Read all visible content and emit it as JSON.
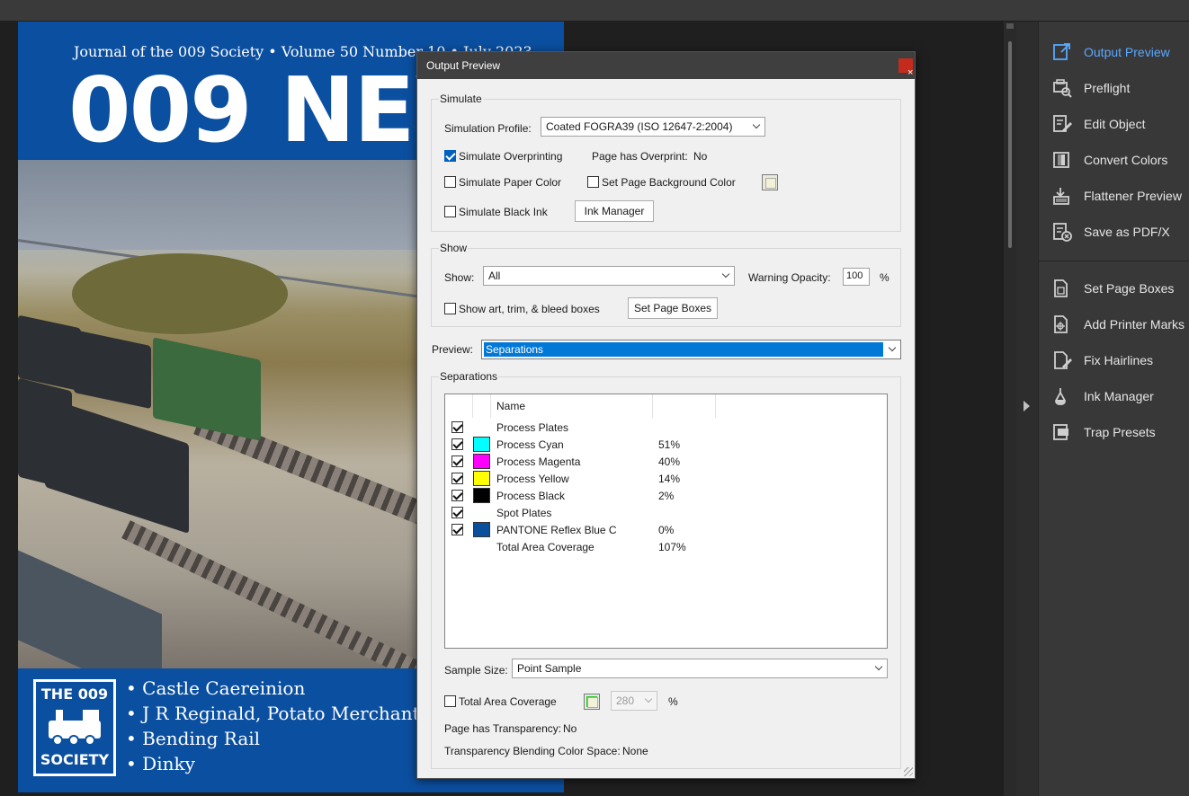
{
  "document": {
    "journal_line": "Journal of the 009 Society • Volume 50 Number 10 • July 2023",
    "big_title": "009 NEWS",
    "logo_top": "THE 009",
    "logo_bottom": "SOCIETY",
    "bullets": [
      "• Castle Caereinion",
      "• J R Reginald, Potato Merchant",
      "• Bending Rail",
      "• Dinky"
    ],
    "brand_blue": "#0b4fa0"
  },
  "tools_panel": {
    "items": [
      {
        "label": "Output Preview",
        "icon": "output-preview-icon",
        "active": true
      },
      {
        "label": "Preflight",
        "icon": "preflight-icon"
      },
      {
        "label": "Edit Object",
        "icon": "edit-object-icon"
      },
      {
        "label": "Convert Colors",
        "icon": "convert-colors-icon"
      },
      {
        "label": "Flattener Preview",
        "icon": "flattener-preview-icon"
      },
      {
        "label": "Save as PDF/X",
        "icon": "save-pdfx-icon"
      },
      {
        "label": "Set Page Boxes",
        "icon": "set-page-boxes-icon"
      },
      {
        "label": "Add Printer Marks",
        "icon": "add-printer-marks-icon"
      },
      {
        "label": "Fix Hairlines",
        "icon": "fix-hairlines-icon"
      },
      {
        "label": "Ink Manager",
        "icon": "ink-manager-icon"
      },
      {
        "label": "Trap Presets",
        "icon": "trap-presets-icon"
      }
    ],
    "active_color": "#5aa8ff"
  },
  "dialog": {
    "title": "Output Preview",
    "close_glyph": "×",
    "simulate": {
      "group_label": "Simulate",
      "profile_label": "Simulation Profile:",
      "profile_value": "Coated FOGRA39 (ISO 12647-2:2004)",
      "overprint_label": "Simulate Overprinting",
      "overprint_checked": true,
      "page_overprint_label": "Page has Overprint:",
      "page_overprint_value": "No",
      "paper_color_label": "Simulate Paper Color",
      "bg_color_label": "Set Page Background Color",
      "black_ink_label": "Simulate Black Ink",
      "ink_manager_button": "Ink Manager"
    },
    "show": {
      "group_label": "Show",
      "show_label": "Show:",
      "show_value": "All",
      "warning_label": "Warning Opacity:",
      "warning_value": "100",
      "warning_unit": "%",
      "boxes_label": "Show art, trim, & bleed boxes",
      "set_page_boxes_button": "Set Page Boxes"
    },
    "preview": {
      "label": "Preview:",
      "value": "Separations"
    },
    "separations": {
      "group_label": "Separations",
      "col_name": "Name",
      "rows": [
        {
          "checked": true,
          "swatch": "",
          "name": "Process Plates",
          "pct": ""
        },
        {
          "checked": true,
          "swatch": "#00ffff",
          "name": "Process Cyan",
          "pct": "51%"
        },
        {
          "checked": true,
          "swatch": "#ff00ff",
          "name": "Process Magenta",
          "pct": "40%"
        },
        {
          "checked": true,
          "swatch": "#ffff00",
          "name": "Process Yellow",
          "pct": "14%"
        },
        {
          "checked": true,
          "swatch": "#000000",
          "name": "Process Black",
          "pct": "2%"
        },
        {
          "checked": true,
          "swatch": "",
          "name": "Spot Plates",
          "pct": ""
        },
        {
          "checked": true,
          "swatch": "#0a4f9c",
          "name": "PANTONE Reflex Blue C",
          "pct": "0%"
        },
        {
          "checked": null,
          "swatch": "",
          "name": "Total Area Coverage",
          "pct": "107%"
        }
      ]
    },
    "sample": {
      "label": "Sample Size:",
      "value": "Point Sample"
    },
    "tac": {
      "label": "Total Area Coverage",
      "color": "#22cc22",
      "value": "280",
      "unit": "%"
    },
    "transparency": {
      "label": "Page has Transparency:",
      "value": "No"
    },
    "blending": {
      "label": "Transparency Blending Color Space:",
      "value": "None"
    }
  }
}
